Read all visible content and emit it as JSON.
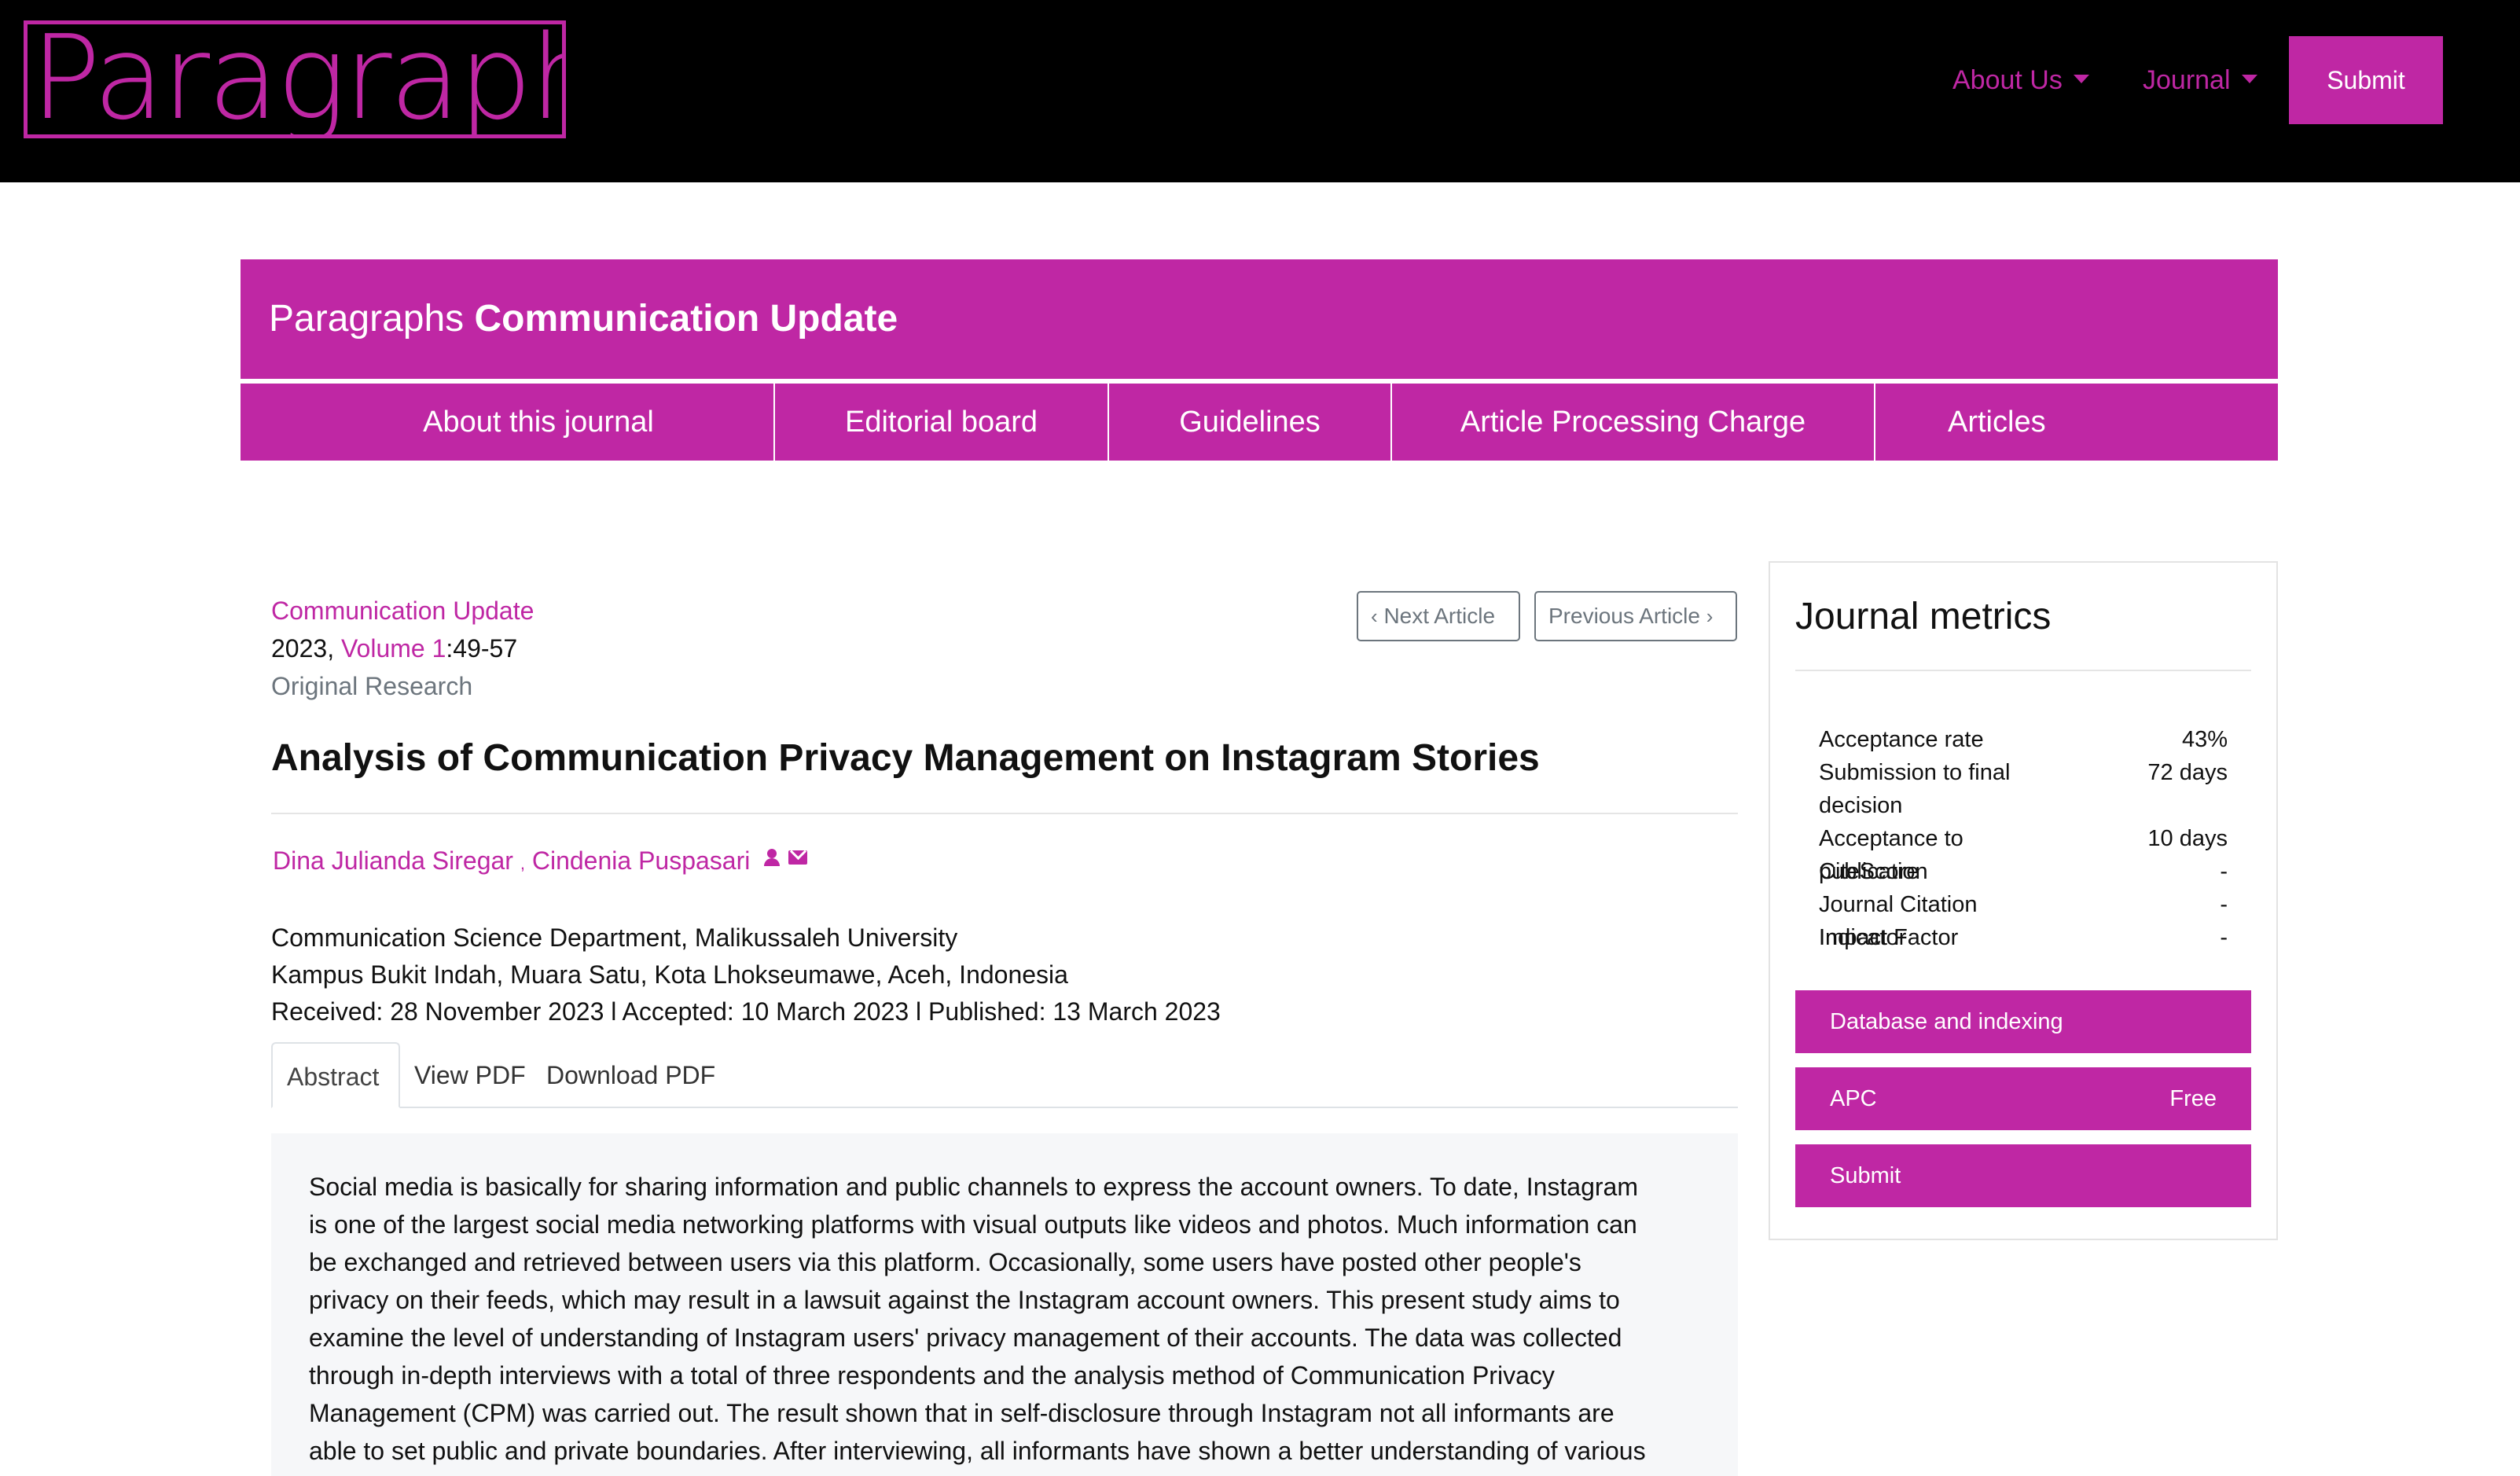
{
  "header": {
    "logo_text": "ParagraphS",
    "nav": [
      {
        "label": "About Us"
      },
      {
        "label": "Journal"
      }
    ],
    "submit_label": "Submit"
  },
  "journal": {
    "name_prefix": "Paragraphs",
    "name_bold": "Communication Update",
    "tabs": [
      {
        "label": "About this journal"
      },
      {
        "label": "Editorial board"
      },
      {
        "label": "Guidelines"
      },
      {
        "label": "Article Processing Charge"
      },
      {
        "label": "Articles"
      }
    ]
  },
  "article": {
    "journal_link": "Communication Update",
    "year": "2023,",
    "volume_link": "Volume 1",
    "pages": ":49-57",
    "type": "Original Research",
    "next_label": "Next Article",
    "prev_label": "Previous Article",
    "title": "Analysis of Communication Privacy Management on Instagram Stories",
    "authors": [
      "Dina Julianda Siregar",
      "Cindenia Puspasari"
    ],
    "author_separator": ",",
    "affiliation": "Communication Science Department, Malikussaleh University",
    "address": "Kampus Bukit Indah, Muara Satu, Kota Lhokseumawe, Aceh, Indonesia",
    "dates": "Received: 28 November 2023 l Accepted: 10 March 2023 l Published: 13 March 2023",
    "tabs": [
      {
        "label": "Abstract",
        "active": true
      },
      {
        "label": "View PDF"
      },
      {
        "label": "Download PDF"
      }
    ],
    "abstract_lines": [
      "Social media is basically for sharing information and public channels to express the account owners. To date, Instagram",
      "is one of the largest social media networking platforms with visual outputs like videos and photos. Much information can",
      "be exchanged and retrieved between users via this platform. Occasionally, some users have posted other people's",
      "privacy on their feeds, which may result in a lawsuit against the Instagram account owners. This present study aims to",
      "examine the level of understanding of Instagram users' privacy management of their accounts. The data was collected",
      "through in-depth interviews with a total of three respondents and the analysis method of Communication Privacy",
      "Management (CPM) was carried out. The result shown that in self-disclosure through Instagram not all informants are",
      "able to set public and private boundaries. After interviewing, all informants have shown a better understanding of various"
    ]
  },
  "metrics": {
    "title": "Journal metrics",
    "items": [
      {
        "label": "Acceptance rate",
        "value": "43%"
      },
      {
        "label": "Submission to final decision",
        "value": "72 days"
      },
      {
        "label": "Acceptance to publication",
        "value": "10 days"
      },
      {
        "label": "CiteScore",
        "value": "-"
      },
      {
        "label": "Journal Citation Indicator",
        "value": "-"
      },
      {
        "label": "Impact Factor",
        "value": "-"
      }
    ],
    "buttons": [
      {
        "label": "Database and indexing",
        "value": ""
      },
      {
        "label": "APC",
        "value": "Free"
      },
      {
        "label": "Submit",
        "value": ""
      }
    ]
  },
  "colors": {
    "brand": "#bf27a4",
    "header_bg": "#000000",
    "abstract_bg": "#f6f7f9"
  }
}
